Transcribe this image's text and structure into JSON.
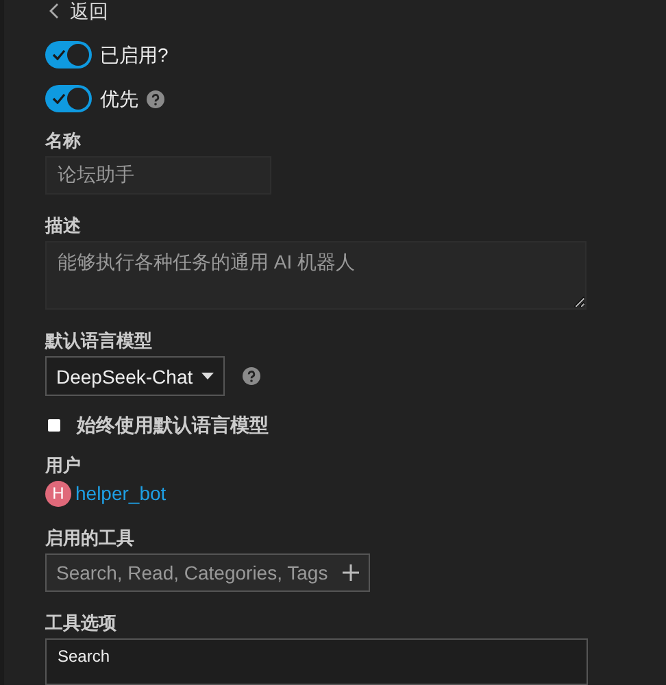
{
  "back": {
    "label": "返回"
  },
  "toggles": [
    {
      "label": "已启用?",
      "on": true,
      "help": false
    },
    {
      "label": "优先",
      "on": true,
      "help": true
    }
  ],
  "name_field": {
    "label": "名称",
    "value": "论坛助手"
  },
  "description_field": {
    "label": "描述",
    "value": "能够执行各种任务的通用 AI 机器人"
  },
  "model": {
    "label": "默认语言模型",
    "value": "DeepSeek-Chat"
  },
  "always_default": {
    "label": "始终使用默认语言模型",
    "checked": false
  },
  "user": {
    "label": "用户",
    "initial": "H",
    "name": "helper_bot"
  },
  "tools": {
    "label": "启用的工具",
    "value": "Search, Read, Categories, Tags"
  },
  "tool_options": {
    "label": "工具选项",
    "items": [
      "Search"
    ]
  }
}
